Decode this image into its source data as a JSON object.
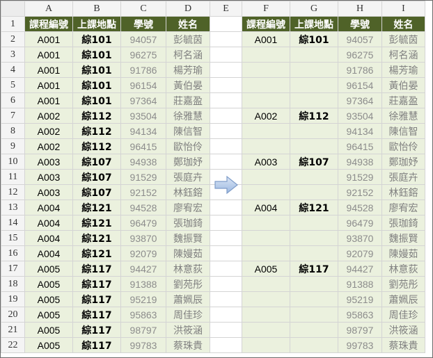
{
  "columns": [
    "A",
    "B",
    "C",
    "D",
    "E",
    "F",
    "G",
    "H",
    "I"
  ],
  "headers": [
    "課程編號",
    "上課地點",
    "學號",
    "姓名"
  ],
  "rows": [
    {
      "num": "2",
      "code": "A001",
      "loc": "綜101",
      "sid": "94057",
      "name": "彭毓茵",
      "first": true
    },
    {
      "num": "3",
      "code": "A001",
      "loc": "綜101",
      "sid": "96275",
      "name": "柯名涵",
      "first": false
    },
    {
      "num": "4",
      "code": "A001",
      "loc": "綜101",
      "sid": "91786",
      "name": "楊芳瑜",
      "first": false
    },
    {
      "num": "5",
      "code": "A001",
      "loc": "綜101",
      "sid": "96154",
      "name": "黃伯晏",
      "first": false
    },
    {
      "num": "6",
      "code": "A001",
      "loc": "綜101",
      "sid": "97364",
      "name": "莊嘉盈",
      "first": false
    },
    {
      "num": "7",
      "code": "A002",
      "loc": "綜112",
      "sid": "93504",
      "name": "徐雅慧",
      "first": true
    },
    {
      "num": "8",
      "code": "A002",
      "loc": "綜112",
      "sid": "94134",
      "name": "陳信智",
      "first": false
    },
    {
      "num": "9",
      "code": "A002",
      "loc": "綜112",
      "sid": "96415",
      "name": "歐怡伶",
      "first": false
    },
    {
      "num": "10",
      "code": "A003",
      "loc": "綜107",
      "sid": "94938",
      "name": "鄭珈妤",
      "first": true
    },
    {
      "num": "11",
      "code": "A003",
      "loc": "綜107",
      "sid": "91529",
      "name": "張庭卉",
      "first": false
    },
    {
      "num": "12",
      "code": "A003",
      "loc": "綜107",
      "sid": "92152",
      "name": "林鈺鎔",
      "first": false
    },
    {
      "num": "13",
      "code": "A004",
      "loc": "綜121",
      "sid": "94528",
      "name": "廖宥宏",
      "first": true
    },
    {
      "num": "14",
      "code": "A004",
      "loc": "綜121",
      "sid": "96479",
      "name": "張珈錡",
      "first": false
    },
    {
      "num": "15",
      "code": "A004",
      "loc": "綜121",
      "sid": "93870",
      "name": "魏振賢",
      "first": false
    },
    {
      "num": "16",
      "code": "A004",
      "loc": "綜121",
      "sid": "92079",
      "name": "陳嫚茹",
      "first": false
    },
    {
      "num": "17",
      "code": "A005",
      "loc": "綜117",
      "sid": "94427",
      "name": "林意荻",
      "first": true
    },
    {
      "num": "18",
      "code": "A005",
      "loc": "綜117",
      "sid": "91388",
      "name": "劉苑彤",
      "first": false
    },
    {
      "num": "19",
      "code": "A005",
      "loc": "綜117",
      "sid": "95219",
      "name": "蕭姵辰",
      "first": false
    },
    {
      "num": "20",
      "code": "A005",
      "loc": "綜117",
      "sid": "95863",
      "name": "周佳珍",
      "first": false
    },
    {
      "num": "21",
      "code": "A005",
      "loc": "綜117",
      "sid": "98797",
      "name": "洪筱涵",
      "first": false
    },
    {
      "num": "22",
      "code": "A005",
      "loc": "綜117",
      "sid": "99783",
      "name": "蔡珠貴",
      "first": false
    }
  ],
  "colors": {
    "header_bg": "#4f6228",
    "data_bg": "#ebf1de",
    "arrow": "#9bb7e0"
  },
  "icons": {
    "arrow": "right-arrow-icon"
  }
}
